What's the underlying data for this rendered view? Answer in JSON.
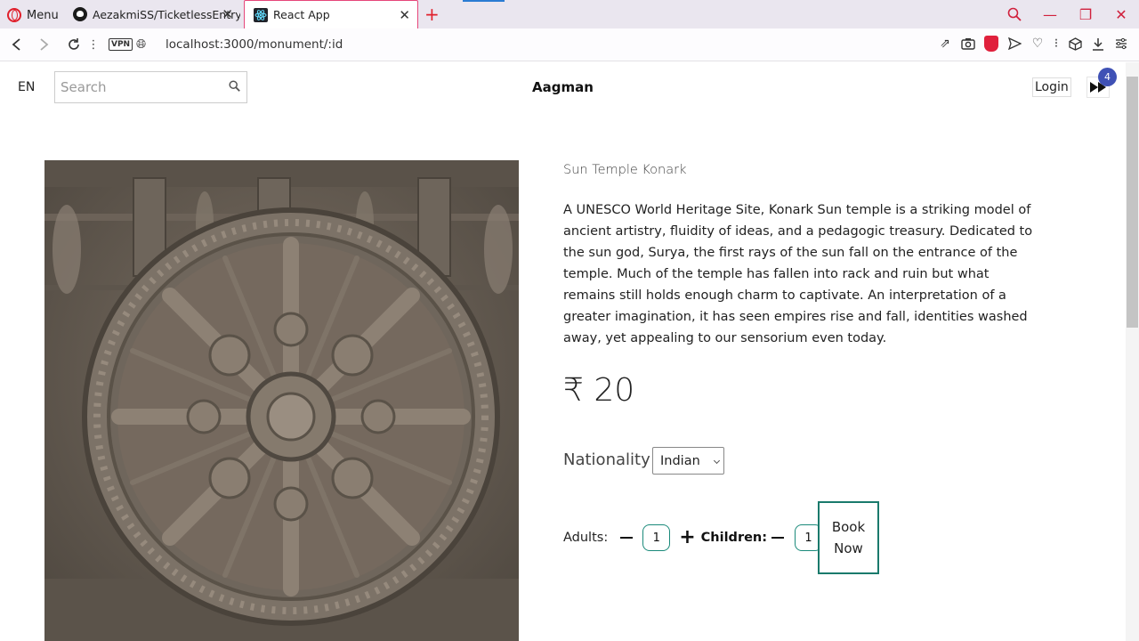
{
  "browser": {
    "menu_label": "Menu",
    "tabs": [
      {
        "title": "AezakmiSS/TicketlessEntry",
        "icon": "github-icon"
      },
      {
        "title": "React App",
        "icon": "react-icon",
        "active": true
      }
    ],
    "url": "localhost:3000/monument/:id",
    "vpn_label": "VPN"
  },
  "header": {
    "lang": "EN",
    "search_placeholder": "Search",
    "brand": "Aagman",
    "login_label": "Login",
    "cart_count": "4"
  },
  "monument": {
    "name": "Sun Temple Konark",
    "description": "A UNESCO World Heritage Site, Konark Sun temple is a striking model of ancient artistry, fluidity of ideas, and a pedagogic treasury. Dedicated to the sun god, Surya, the first rays of the sun fall on the entrance of the temple. Much of the temple has fallen into rack and ruin but what remains still holds enough charm to captivate. An interpretation of a greater imagination, it has seen empires rise and fall, identities washed away, yet appealing to our sensorium even today.",
    "price": "₹ 20",
    "image_alt": "Konark Sun Temple chariot wheel"
  },
  "booking": {
    "nationality_label": "Nationality",
    "nationality_value": "Indian",
    "adults_label": "Adults:",
    "adults_count": "1",
    "children_label": "Children:",
    "children_count": "1",
    "book_label": "Book Now"
  },
  "colors": {
    "accent": "#1a7a6c",
    "badge": "#3f51b5",
    "opera_red": "#e0202c"
  }
}
